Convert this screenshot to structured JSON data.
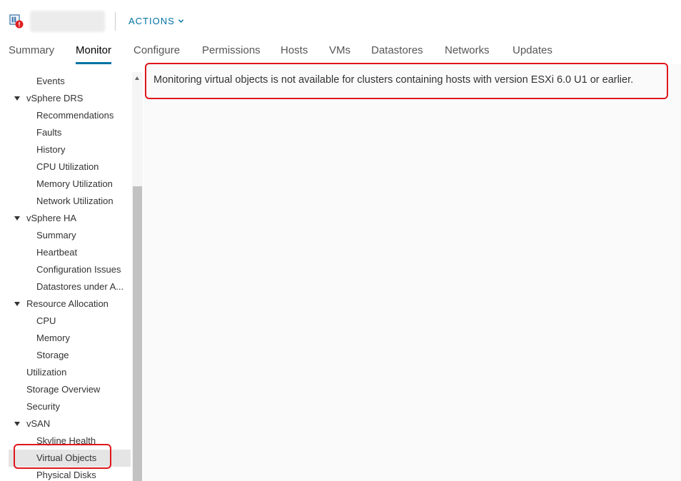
{
  "header": {
    "object_name": "",
    "actions_label": "ACTIONS"
  },
  "tabs": [
    {
      "label": "Summary",
      "active": false
    },
    {
      "label": "Monitor",
      "active": true
    },
    {
      "label": "Configure",
      "active": false
    },
    {
      "label": "Permissions",
      "active": false
    },
    {
      "label": "Hosts",
      "active": false
    },
    {
      "label": "VMs",
      "active": false
    },
    {
      "label": "Datastores",
      "active": false
    },
    {
      "label": "Networks",
      "active": false
    },
    {
      "label": "Updates",
      "active": false
    }
  ],
  "sidebar": {
    "items": [
      {
        "label": "Events"
      },
      {
        "label": "vSphere DRS"
      },
      {
        "label": "Recommendations"
      },
      {
        "label": "Faults"
      },
      {
        "label": "History"
      },
      {
        "label": "CPU Utilization"
      },
      {
        "label": "Memory Utilization"
      },
      {
        "label": "Network Utilization"
      },
      {
        "label": "vSphere HA"
      },
      {
        "label": "Summary"
      },
      {
        "label": "Heartbeat"
      },
      {
        "label": "Configuration Issues"
      },
      {
        "label": "Datastores under A..."
      },
      {
        "label": "Resource Allocation"
      },
      {
        "label": "CPU"
      },
      {
        "label": "Memory"
      },
      {
        "label": "Storage"
      },
      {
        "label": "Utilization"
      },
      {
        "label": "Storage Overview"
      },
      {
        "label": "Security"
      },
      {
        "label": "vSAN"
      },
      {
        "label": "Skyline Health"
      },
      {
        "label": "Virtual Objects",
        "selected": true
      },
      {
        "label": "Physical Disks"
      }
    ]
  },
  "main": {
    "message": "Monitoring virtual objects is not available for clusters containing hosts with version ESXi 6.0 U1 or earlier."
  },
  "colors": {
    "accent": "#0072a3",
    "highlight": "#e0161b",
    "alert": "#e02020"
  }
}
